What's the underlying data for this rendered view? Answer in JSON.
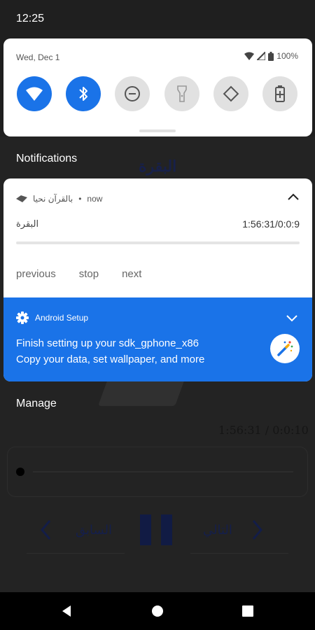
{
  "status_bar": {
    "time": "12:25"
  },
  "quick_settings": {
    "date": "Wed, Dec 1",
    "battery": "100%",
    "tiles": [
      {
        "name": "wifi",
        "icon": "wifi-icon",
        "on": true
      },
      {
        "name": "bluetooth",
        "icon": "bluetooth-icon",
        "on": true
      },
      {
        "name": "do-not-disturb",
        "icon": "do-not-disturb-icon",
        "on": false
      },
      {
        "name": "flashlight",
        "icon": "flashlight-icon",
        "on": false
      },
      {
        "name": "auto-rotate",
        "icon": "auto-rotate-icon",
        "on": false
      },
      {
        "name": "battery-saver",
        "icon": "battery-saver-icon",
        "on": false
      }
    ]
  },
  "notifications": {
    "heading": "Notifications",
    "media": {
      "app_name": "بالقرآن نحيا",
      "when": "now",
      "track": "البقرة",
      "time": "1:56:31/0:0:9",
      "progress": 0.0,
      "actions": {
        "previous": "previous",
        "stop": "stop",
        "next": "next"
      }
    },
    "setup": {
      "app": "Android Setup",
      "line1": "Finish setting up your sdk_gphone_x86",
      "line2": "Copy your data, set wallpaper, and more"
    },
    "manage": "Manage"
  },
  "background_app": {
    "title": "البقرة",
    "time": "1:56:31 / 0:0:10",
    "prev_label": "السابق",
    "next_label": "التالي"
  },
  "colors": {
    "accent": "#1a73e8",
    "card": "#ffffff",
    "scrim": "#1f1f1f"
  }
}
